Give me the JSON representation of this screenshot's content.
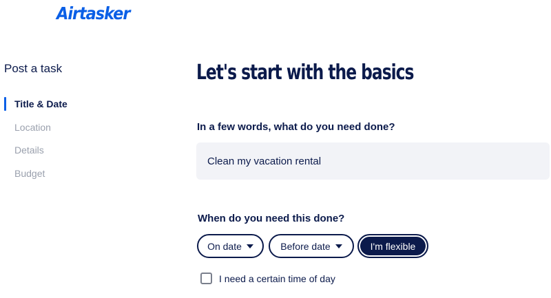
{
  "brand": {
    "logo_text": "Airtasker"
  },
  "sidebar": {
    "title": "Post a task",
    "steps": [
      {
        "label": "Title & Date",
        "active": true
      },
      {
        "label": "Location",
        "active": false
      },
      {
        "label": "Details",
        "active": false
      },
      {
        "label": "Budget",
        "active": false
      }
    ]
  },
  "main": {
    "heading": "Let's start with the basics",
    "task_question": "In a few words, what do you need done?",
    "task_value": "Clean my vacation rental",
    "date_question": "When do you need this done?",
    "date_options": {
      "on_date": "On date",
      "before_date": "Before date",
      "flexible": "I'm flexible"
    },
    "selected_option": "flexible",
    "time_checkbox_label": "I need a certain time of day",
    "time_checkbox_checked": false
  },
  "colors": {
    "brand_blue": "#0a5fe6",
    "navy": "#0b1a4b",
    "muted": "#9aa0ad",
    "input_bg": "#f2f3f7"
  }
}
